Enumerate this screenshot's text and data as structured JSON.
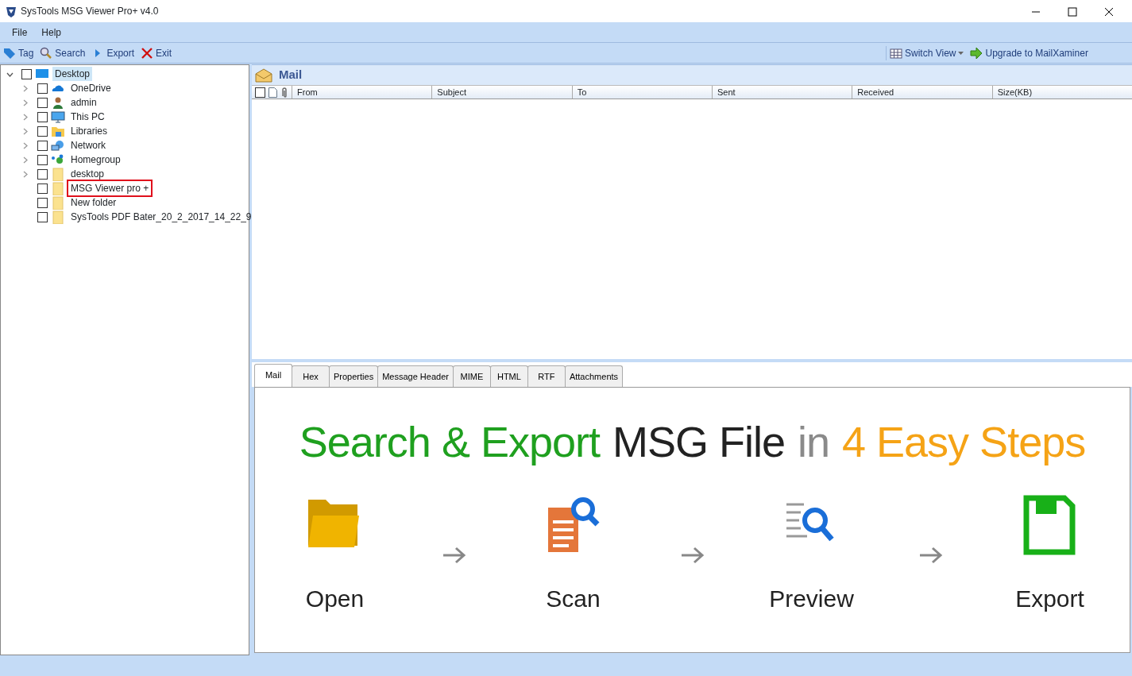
{
  "window": {
    "title": "SysTools MSG Viewer Pro+ v4.0"
  },
  "menu": [
    "File",
    "Help"
  ],
  "toolbar": [
    {
      "label": "Tag",
      "kind": "tag"
    },
    {
      "label": "Search",
      "kind": "search"
    },
    {
      "label": "Export",
      "kind": "export"
    },
    {
      "label": "Exit",
      "kind": "exit"
    }
  ],
  "toolbar_right": [
    {
      "label": "Switch View",
      "kind": "switch"
    },
    {
      "label": "Upgrade to MailXaminer",
      "kind": "upgrade"
    }
  ],
  "tree": [
    {
      "label": "Desktop",
      "kind": "desktop",
      "checked": false,
      "expanded": true,
      "selected": true,
      "highlighted": false,
      "children": [
        {
          "label": "OneDrive",
          "kind": "cloud",
          "checked": false,
          "expandable": true,
          "selected": false,
          "highlighted": false
        },
        {
          "label": "admin",
          "kind": "user",
          "checked": false,
          "expandable": true,
          "selected": false,
          "highlighted": false
        },
        {
          "label": "This PC",
          "kind": "pc",
          "checked": false,
          "expandable": true,
          "selected": false,
          "highlighted": false
        },
        {
          "label": "Libraries",
          "kind": "library",
          "checked": false,
          "expandable": true,
          "selected": false,
          "highlighted": false
        },
        {
          "label": "Network",
          "kind": "network",
          "checked": false,
          "expandable": true,
          "selected": false,
          "highlighted": false
        },
        {
          "label": "Homegroup",
          "kind": "homegroup",
          "checked": false,
          "expandable": true,
          "selected": false,
          "highlighted": false
        },
        {
          "label": "desktop",
          "kind": "folder",
          "checked": false,
          "expandable": true,
          "selected": false,
          "highlighted": false
        },
        {
          "label": "MSG Viewer pro +",
          "kind": "folder",
          "checked": false,
          "expandable": false,
          "selected": false,
          "highlighted": true
        },
        {
          "label": "New folder",
          "kind": "folder",
          "checked": false,
          "expandable": false,
          "selected": false,
          "highlighted": false
        },
        {
          "label": "SysTools PDF Bater_20_2_2017_14_22_9",
          "kind": "folder",
          "checked": false,
          "expandable": false,
          "selected": false,
          "highlighted": false
        }
      ]
    }
  ],
  "mail_panel": {
    "title": "Mail",
    "select_all_checked": false,
    "columns": [
      "From",
      "Subject",
      "To",
      "Sent",
      "Received",
      "Size(KB)"
    ]
  },
  "tabs": [
    {
      "label": "Mail",
      "selected": true
    },
    {
      "label": "Hex",
      "selected": false
    },
    {
      "label": "Properties",
      "selected": false
    },
    {
      "label": "Message Header",
      "selected": false
    },
    {
      "label": "MIME",
      "selected": false
    },
    {
      "label": "HTML",
      "selected": false
    },
    {
      "label": "RTF",
      "selected": false
    },
    {
      "label": "Attachments",
      "selected": false
    }
  ],
  "banner": {
    "headline": [
      {
        "text": "Search & Export",
        "color": "#1fa01f"
      },
      {
        "text": "MSG File",
        "color": "#222222"
      },
      {
        "text": "in",
        "color": "#8a8a8a"
      },
      {
        "text": "4 Easy Steps",
        "color": "#f5a316"
      }
    ],
    "steps": [
      {
        "label": "Open",
        "kind": "open"
      },
      {
        "label": "Scan",
        "kind": "scan"
      },
      {
        "label": "Preview",
        "kind": "preview"
      },
      {
        "label": "Export",
        "kind": "export"
      }
    ]
  }
}
